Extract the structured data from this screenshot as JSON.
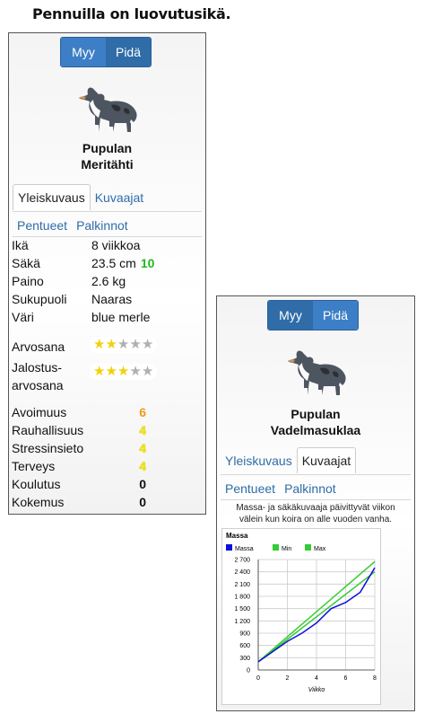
{
  "heading": "Pennuilla on luovutusikä.",
  "colors": {
    "accent_active": "#2f6ca8",
    "accent": "#3d7fc6",
    "link": "#2f6ca8",
    "green": "#22b822",
    "yellow": "#f4e400",
    "orange": "#f09a18",
    "star": "#f1d10a"
  },
  "card1": {
    "buttons": {
      "sell": "Myy",
      "keep": "Pidä"
    },
    "dog_name_line1": "Pupulan",
    "dog_name_line2": "Meritähti",
    "tabs": {
      "overview": "Yleiskuvaus",
      "charts": "Kuvaajat",
      "litters": "Pentueet",
      "awards": "Palkinnot"
    },
    "info": [
      {
        "label": "Ikä",
        "value": "8 viikkoa"
      },
      {
        "label": "Säkä",
        "value": "23.5 cm",
        "badge": "10"
      },
      {
        "label": "Paino",
        "value": "2.6 kg"
      },
      {
        "label": "Sukupuoli",
        "value": "Naaras"
      },
      {
        "label": "Väri",
        "value": "blue merle"
      }
    ],
    "rating_label": "Arvosana",
    "rating_stars": 2,
    "breeding_label_1": "Jalostus-",
    "breeding_label_2": "arvosana",
    "breeding_stars": 3,
    "stats": [
      {
        "label": "Avoimuus",
        "value": "6",
        "color": "orange"
      },
      {
        "label": "Rauhallisuus",
        "value": "4",
        "color": "yellow"
      },
      {
        "label": "Stressinsieto",
        "value": "4",
        "color": "yellow"
      },
      {
        "label": "Terveys",
        "value": "4",
        "color": "yellow"
      },
      {
        "label": "Koulutus",
        "value": "0",
        "color": "black"
      },
      {
        "label": "Kokemus",
        "value": "0",
        "color": "black"
      }
    ]
  },
  "card2": {
    "buttons": {
      "sell": "Myy",
      "keep": "Pidä"
    },
    "dog_name_line1": "Pupulan",
    "dog_name_line2": "Vadelmasuklaa",
    "tabs": {
      "overview": "Yleiskuvaus",
      "charts": "Kuvaajat",
      "litters": "Pentueet",
      "awards": "Palkinnot"
    },
    "note_line1": "Massa- ja säkäkuvaaja päivittyvät viikon",
    "note_line2": "välein kun koira on alle vuoden vanha.",
    "chart_data": {
      "type": "line",
      "title": "Massa",
      "xlabel": "Viikko",
      "ylabel": "",
      "xlim": [
        0,
        8
      ],
      "ylim": [
        0,
        2700
      ],
      "x_ticks": [
        "0",
        "2",
        "4",
        "6",
        "8"
      ],
      "y_ticks": [
        "0",
        "300",
        "600",
        "900",
        "1 200",
        "1 500",
        "1 800",
        "2 100",
        "2 400",
        "2 700"
      ],
      "legend_position": "top",
      "grid": true,
      "series": [
        {
          "name": "Massa",
          "color": "#1010d8",
          "x": [
            0,
            1,
            2,
            3,
            4,
            5,
            6,
            7,
            8
          ],
          "y": [
            200,
            450,
            700,
            900,
            1150,
            1500,
            1650,
            1900,
            2500
          ]
        },
        {
          "name": "Min",
          "color": "#33cc33",
          "x": [
            0,
            8
          ],
          "y": [
            200,
            2400
          ]
        },
        {
          "name": "Max",
          "color": "#33cc33",
          "x": [
            0,
            8
          ],
          "y": [
            200,
            2650
          ]
        }
      ]
    }
  }
}
